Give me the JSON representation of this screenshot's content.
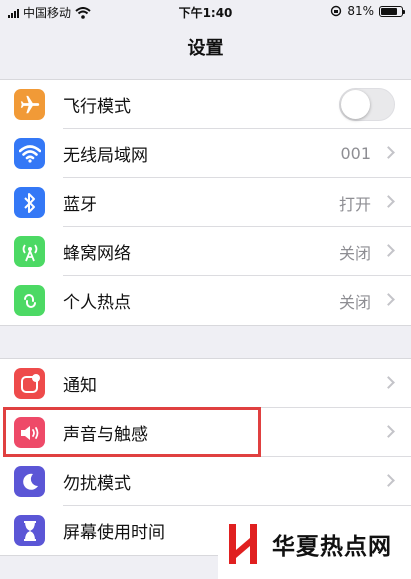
{
  "status_bar": {
    "carrier": "中国移动",
    "time": "下午1:40",
    "battery_percent_label": "81%",
    "battery_level": 0.81
  },
  "nav": {
    "title": "设置"
  },
  "groups": [
    {
      "items": [
        {
          "label": "飞行模式",
          "icon": "airplane-icon",
          "icon_color": "#f19a37",
          "control": "toggle",
          "toggle_on": false
        },
        {
          "label": "无线局域网",
          "icon": "wifi-icon",
          "icon_color": "#3478f6",
          "value": "001",
          "control": "chevron"
        },
        {
          "label": "蓝牙",
          "icon": "bluetooth-icon",
          "icon_color": "#3478f6",
          "value": "打开",
          "control": "chevron"
        },
        {
          "label": "蜂窝网络",
          "icon": "cellular-icon",
          "icon_color": "#4cd964",
          "value": "关闭",
          "control": "chevron"
        },
        {
          "label": "个人热点",
          "icon": "hotspot-icon",
          "icon_color": "#4cd964",
          "value": "关闭",
          "control": "chevron"
        }
      ]
    },
    {
      "items": [
        {
          "label": "通知",
          "icon": "notifications-icon",
          "icon_color": "#ee4b4b",
          "control": "chevron"
        },
        {
          "label": "声音与触感",
          "icon": "sound-icon",
          "icon_color": "#ee4a68",
          "control": "chevron"
        },
        {
          "label": "勿扰模式",
          "icon": "moon-icon",
          "icon_color": "#5b56d6",
          "control": "chevron"
        },
        {
          "label": "屏幕使用时间",
          "icon": "hourglass-icon",
          "icon_color": "#5b56d6",
          "control": "chevron"
        }
      ]
    }
  ],
  "highlight_color": "#e04040",
  "watermark": {
    "text": "华夏热点网",
    "logo_color": "#e02020"
  }
}
